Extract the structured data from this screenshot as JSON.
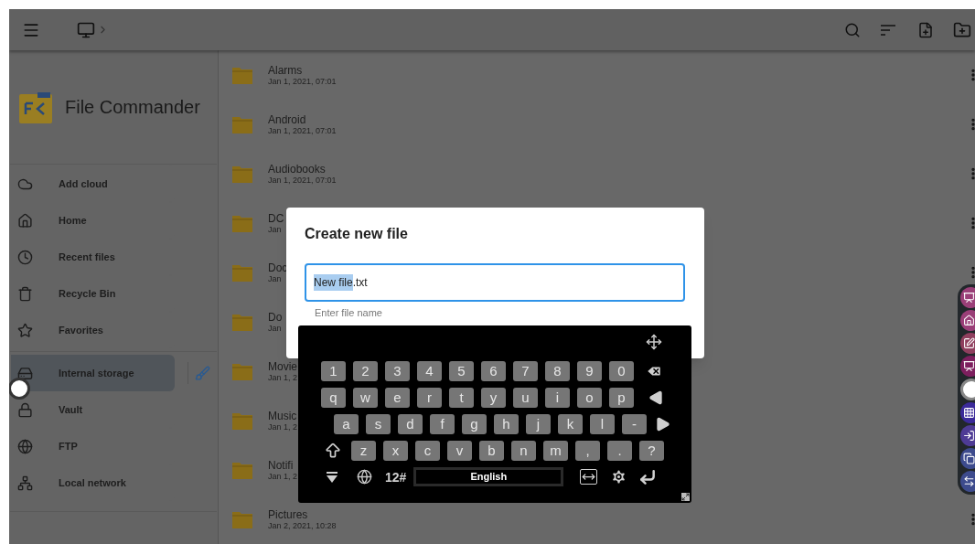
{
  "sidebar": {
    "app_name": "File Commander",
    "items": [
      {
        "kind": "cloud",
        "label": "Add cloud",
        "selected": false
      },
      {
        "kind": "home",
        "label": "Home",
        "selected": false
      },
      {
        "kind": "clock",
        "label": "Recent files",
        "selected": false
      },
      {
        "kind": "trash",
        "label": "Recycle Bin",
        "selected": false
      },
      {
        "kind": "star",
        "label": "Favorites",
        "selected": false
      },
      {
        "kind": "divider"
      },
      {
        "kind": "storage",
        "label": "Internal storage",
        "selected": true
      },
      {
        "kind": "lock",
        "label": "Vault",
        "selected": false
      },
      {
        "kind": "globe",
        "label": "FTP",
        "selected": false
      },
      {
        "kind": "network",
        "label": "Local network",
        "selected": false
      }
    ]
  },
  "files": [
    {
      "name": "Alarms",
      "date": "Jan 1, 2021, 07:01"
    },
    {
      "name": "Android",
      "date": "Jan 1, 2021, 07:01"
    },
    {
      "name": "Audiobooks",
      "date": "Jan 1, 2021, 07:01"
    },
    {
      "name": "DC",
      "date": "Jan"
    },
    {
      "name": "Doc",
      "date": "Jan"
    },
    {
      "name": "Do",
      "date": "Jan"
    },
    {
      "name": "Movie",
      "date": "Jan 1, 2"
    },
    {
      "name": "Music",
      "date": "Jan 1, 2"
    },
    {
      "name": "Notifi",
      "date": "Jan 1, 2"
    },
    {
      "name": "Pictures",
      "date": "Jan 2, 2021, 10:28"
    }
  ],
  "dialog": {
    "title": "Create new file",
    "selected_text": "New file",
    "unselected_text": ".txt",
    "helper": "Enter file name"
  },
  "keyboard": {
    "rows": [
      [
        {
          "kind": "key",
          "label": "1"
        },
        {
          "kind": "key",
          "label": "2"
        },
        {
          "kind": "key",
          "label": "3"
        },
        {
          "kind": "key",
          "label": "4"
        },
        {
          "kind": "key",
          "label": "5"
        },
        {
          "kind": "key",
          "label": "6"
        },
        {
          "kind": "key",
          "label": "7"
        },
        {
          "kind": "key",
          "label": "8"
        },
        {
          "kind": "key",
          "label": "9"
        },
        {
          "kind": "key",
          "label": "0"
        },
        {
          "kind": "backspace"
        }
      ],
      [
        {
          "kind": "key",
          "label": "q"
        },
        {
          "kind": "key",
          "label": "w"
        },
        {
          "kind": "key",
          "label": "e"
        },
        {
          "kind": "key",
          "label": "r"
        },
        {
          "kind": "key",
          "label": "t"
        },
        {
          "kind": "key",
          "label": "y"
        },
        {
          "kind": "key",
          "label": "u"
        },
        {
          "kind": "key",
          "label": "i"
        },
        {
          "kind": "key",
          "label": "o"
        },
        {
          "kind": "key",
          "label": "p"
        },
        {
          "kind": "left"
        }
      ],
      [
        {
          "kind": "key",
          "label": "a"
        },
        {
          "kind": "key",
          "label": "s"
        },
        {
          "kind": "key",
          "label": "d"
        },
        {
          "kind": "key",
          "label": "f"
        },
        {
          "kind": "key",
          "label": "g"
        },
        {
          "kind": "key",
          "label": "h"
        },
        {
          "kind": "key",
          "label": "j"
        },
        {
          "kind": "key",
          "label": "k"
        },
        {
          "kind": "key",
          "label": "l"
        },
        {
          "kind": "key",
          "label": "-"
        },
        {
          "kind": "right"
        }
      ],
      [
        {
          "kind": "shift"
        },
        {
          "kind": "key",
          "label": "z"
        },
        {
          "kind": "key",
          "label": "x"
        },
        {
          "kind": "key",
          "label": "c"
        },
        {
          "kind": "key",
          "label": "v"
        },
        {
          "kind": "key",
          "label": "b"
        },
        {
          "kind": "key",
          "label": "n"
        },
        {
          "kind": "key",
          "label": "m"
        },
        {
          "kind": "key",
          "label": ","
        },
        {
          "kind": "key",
          "label": "."
        },
        {
          "kind": "key",
          "label": "?"
        }
      ]
    ],
    "function_bar": [
      {
        "kind": "hide"
      },
      {
        "kind": "globe"
      },
      {
        "kind": "text",
        "label": "12#"
      },
      {
        "kind": "space",
        "label": "English"
      },
      {
        "kind": "cursor"
      },
      {
        "kind": "settings"
      },
      {
        "kind": "enter"
      }
    ]
  }
}
